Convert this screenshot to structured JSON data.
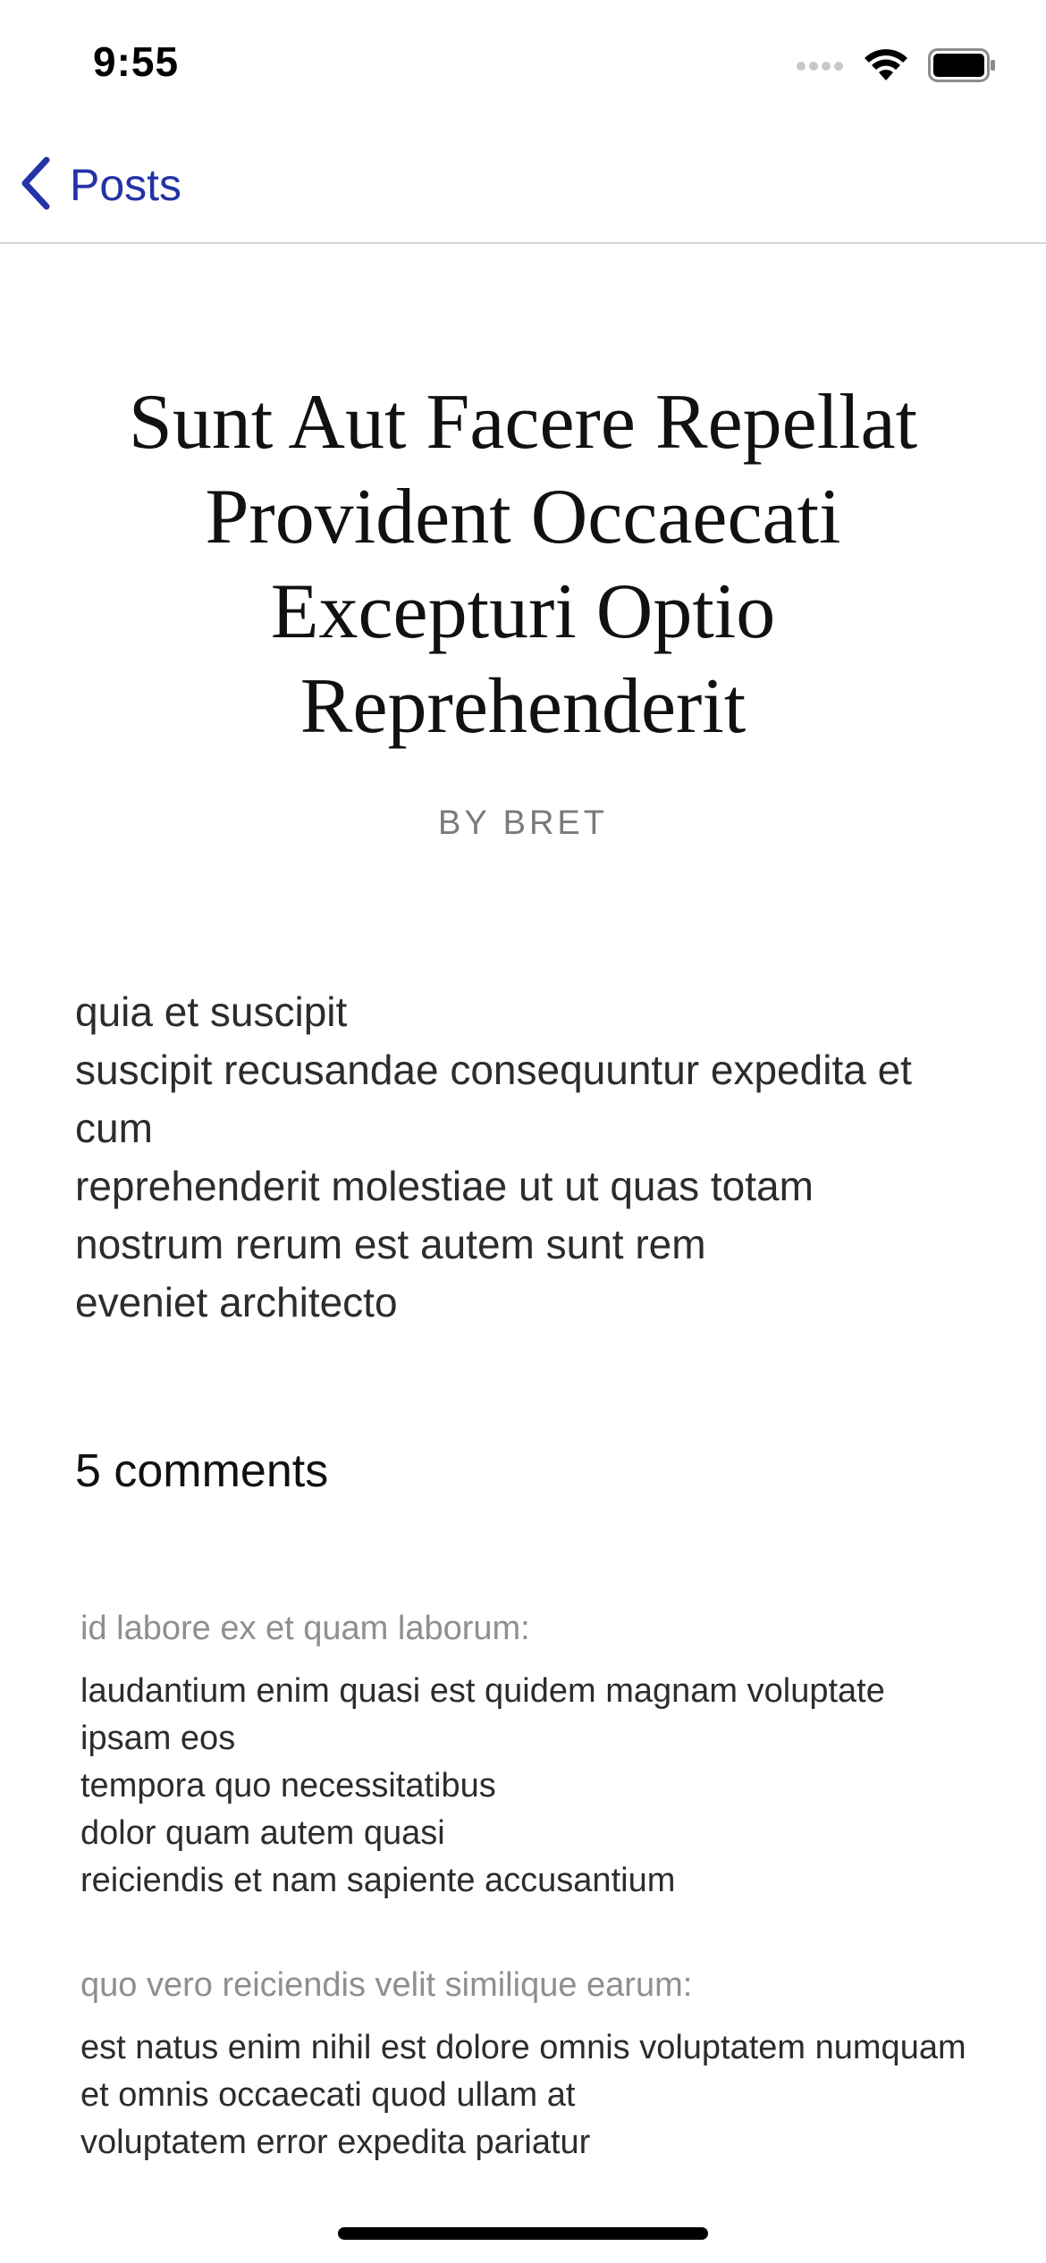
{
  "status_bar": {
    "time": "9:55",
    "icons": [
      "signal-icon",
      "wifi-icon",
      "battery-icon"
    ]
  },
  "nav": {
    "back_label": "Posts",
    "back_icon": "chevron-left-icon",
    "accent_color": "#2433a6"
  },
  "post": {
    "title": "Sunt Aut Facere Repellat Provident Occaecati Excepturi Optio Reprehenderit",
    "author": "BY BRET",
    "body": "quia et suscipit\nsuscipit recusandae consequuntur expedita et cum\nreprehenderit molestiae ut ut quas totam\nnostrum rerum est autem sunt rem\neveniet architecto"
  },
  "comments": {
    "heading": "5 comments",
    "items": [
      {
        "name": "id labore ex et quam laborum:",
        "body": "laudantium enim quasi est quidem magnam voluptate ipsam eos\ntempora quo necessitatibus\ndolor quam autem quasi\nreiciendis et nam sapiente accusantium"
      },
      {
        "name": "quo vero reiciendis velit similique earum:",
        "body": "est natus enim nihil est dolore omnis voluptatem numquam\net omnis occaecati quod ullam at\nvoluptatem error expedita pariatur"
      }
    ]
  }
}
